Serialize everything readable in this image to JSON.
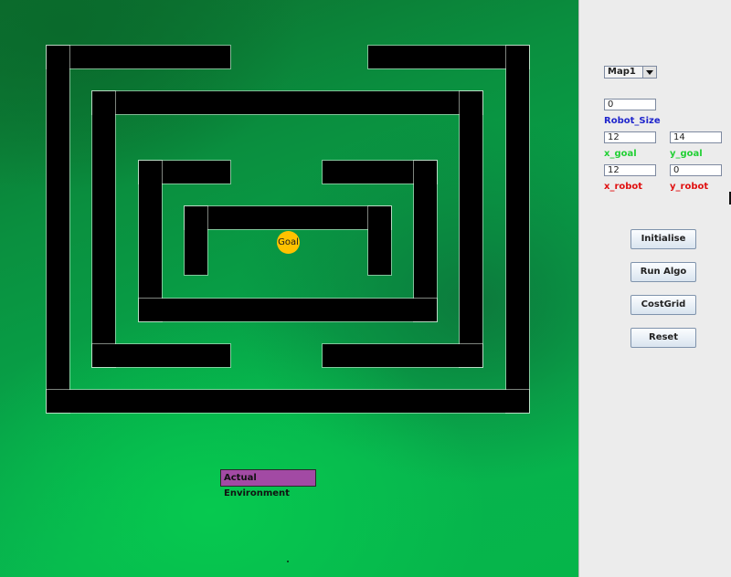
{
  "environment": {
    "goal_label": "Goal",
    "caption": "Actual Environment",
    "colors": {
      "wall": "#000000",
      "goal": "#ffc200",
      "caption_bg": "#a24aa4",
      "background": "#0a8f3f"
    }
  },
  "controls": {
    "map_select": {
      "selected": "Map1"
    },
    "robot_size": {
      "value": "0",
      "label": "Robot_Size"
    },
    "x_goal": {
      "value": "12",
      "label": "x_goal"
    },
    "y_goal": {
      "value": "14",
      "label": "y_goal"
    },
    "x_robot": {
      "value": "12",
      "label": "x_robot"
    },
    "y_robot": {
      "value": "0",
      "label": "y_robot"
    },
    "buttons": {
      "initialise": "Initialise",
      "run_algo": "Run Algo",
      "cost_grid": "CostGrid",
      "reset": "Reset"
    },
    "label_colors": {
      "size": "#1f25cc",
      "goal": "#22d035",
      "robot": "#e01010"
    }
  }
}
